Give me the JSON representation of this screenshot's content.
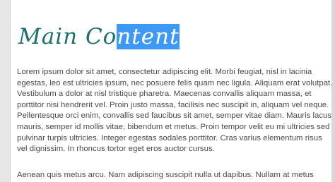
{
  "main": {
    "title_unselected": "Main Co",
    "title_selected": "ntent",
    "paragraphs": [
      "Lorem ipsum dolor sit amet, consectetur adipiscing elit. Morbi feugiat, nisl in lacinia egestas, leo est ultricies ipsum, nec posuere felis quam nec ligula. Aliquam erat volutpat. Vestibulum a dolor at nisl tristique pharetra. Maecenas convallis aliquam massa, et porttitor nisi hendrerit vel. Proin justo massa, facilisis nec suscipit in, aliquam vel neque. Pellentesque orci enim, convallis sed faucibus sit amet, semper vitae diam. Mauris lacus mauris, semper id mollis vitae, bibendum et metus. Proin tempor velit eu mi ultricies sed pulvinar turpis ultricies. Integer egestas sodales porttitor. Cras varius elementum risus vel dignissim. In rhoncus tortor eget eros auctor cursus.",
      "Aenean quis metus arcu. Nam adipiscing suscipit nulla ut dapibus. Nullam at metus"
    ]
  },
  "colors": {
    "title": "#1b6f6e",
    "selection": "#3e99f5",
    "body_text": "#4b4b4b"
  }
}
